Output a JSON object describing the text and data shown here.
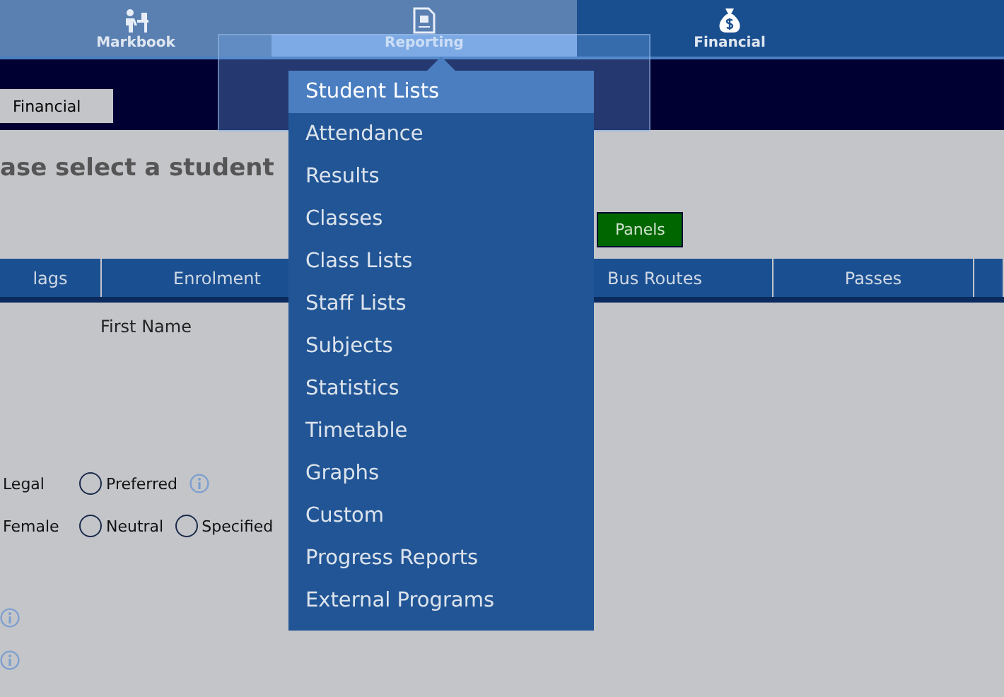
{
  "nav": [
    {
      "label": "Markbook",
      "highlighted": true,
      "selected": false
    },
    {
      "label": "Reporting",
      "highlighted": true,
      "selected": true
    },
    {
      "label": "Financial",
      "highlighted": false,
      "selected": false
    }
  ],
  "subnav": {
    "button": "Financial"
  },
  "heading": "ase select a student",
  "view_toggle": {
    "label": "Panels",
    "selected": true
  },
  "table": {
    "columns": [
      {
        "label": "lags"
      },
      {
        "label": "Enrolment"
      },
      {},
      {
        "label": "Bus Routes"
      },
      {
        "label": "Passes"
      },
      {}
    ]
  },
  "form": {
    "first_name_label": "First Name",
    "name_row": [
      {
        "kind": "text",
        "label": "Legal"
      },
      {
        "kind": "radio",
        "label": "Preferred",
        "selected": false
      },
      {
        "kind": "info"
      }
    ],
    "gender_row": [
      {
        "kind": "text",
        "label": "Female"
      },
      {
        "kind": "radio",
        "label": "Neutral",
        "selected": false
      },
      {
        "kind": "radio",
        "label": "Specified",
        "selected": false
      }
    ]
  },
  "menu": {
    "items": [
      {
        "label": "Student Lists",
        "selected": true
      },
      {
        "label": "Attendance",
        "selected": false
      },
      {
        "label": "Results",
        "selected": false
      },
      {
        "label": "Classes",
        "selected": false
      },
      {
        "label": "Class Lists",
        "selected": false
      },
      {
        "label": "Staff Lists",
        "selected": false
      },
      {
        "label": "Subjects",
        "selected": false
      },
      {
        "label": "Statistics",
        "selected": false
      },
      {
        "label": "Timetable",
        "selected": false
      },
      {
        "label": "Graphs",
        "selected": false
      },
      {
        "label": "Custom",
        "selected": false
      },
      {
        "label": "Progress Reports",
        "selected": false
      },
      {
        "label": "External Programs",
        "selected": false
      }
    ]
  }
}
